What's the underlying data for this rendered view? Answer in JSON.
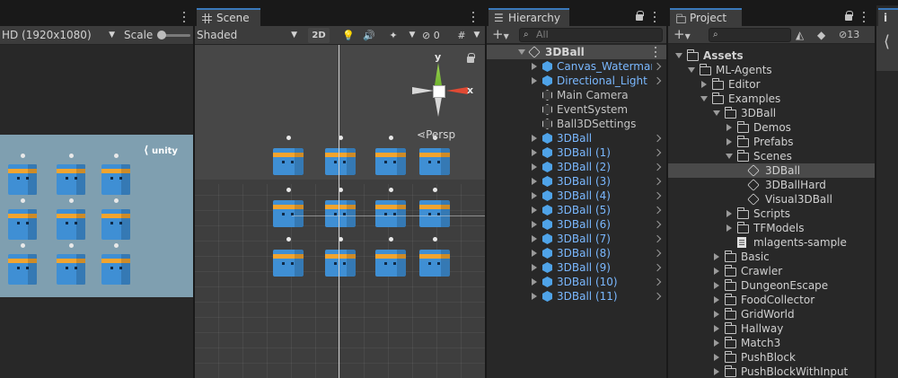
{
  "game": {
    "resolution": "HD (1920x1080)",
    "scale_label": "Scale",
    "logo_text": "unity"
  },
  "scene": {
    "tab_label": "Scene",
    "shading_mode": "Shaded",
    "btn_2d": "2D",
    "hidden_count": "0",
    "persp_label": "Persp",
    "axis_y": "y",
    "axis_x": "x"
  },
  "hierarchy": {
    "tab_label": "Hierarchy",
    "search_placeholder": "All",
    "root": "3DBall",
    "items": [
      {
        "label": "Canvas_Watermark",
        "type": "prefab",
        "expandable": true
      },
      {
        "label": "Directional_Light",
        "type": "prefab",
        "expandable": true
      },
      {
        "label": "Main Camera",
        "type": "object",
        "expandable": false
      },
      {
        "label": "EventSystem",
        "type": "object",
        "expandable": false
      },
      {
        "label": "Ball3DSettings",
        "type": "object",
        "expandable": false
      },
      {
        "label": "3DBall",
        "type": "prefab",
        "expandable": true
      },
      {
        "label": "3DBall (1)",
        "type": "prefab",
        "expandable": true
      },
      {
        "label": "3DBall (2)",
        "type": "prefab",
        "expandable": true
      },
      {
        "label": "3DBall (3)",
        "type": "prefab",
        "expandable": true
      },
      {
        "label": "3DBall (4)",
        "type": "prefab",
        "expandable": true
      },
      {
        "label": "3DBall (5)",
        "type": "prefab",
        "expandable": true
      },
      {
        "label": "3DBall (6)",
        "type": "prefab",
        "expandable": true
      },
      {
        "label": "3DBall (7)",
        "type": "prefab",
        "expandable": true
      },
      {
        "label": "3DBall (8)",
        "type": "prefab",
        "expandable": true
      },
      {
        "label": "3DBall (9)",
        "type": "prefab",
        "expandable": true
      },
      {
        "label": "3DBall (10)",
        "type": "prefab",
        "expandable": true
      },
      {
        "label": "3DBall (11)",
        "type": "prefab",
        "expandable": true
      }
    ]
  },
  "project": {
    "tab_label": "Project",
    "hidden_count": "13",
    "items": [
      {
        "label": "Assets",
        "depth": 0,
        "kind": "folder",
        "state": "open",
        "bold": true
      },
      {
        "label": "ML-Agents",
        "depth": 1,
        "kind": "folder",
        "state": "open"
      },
      {
        "label": "Editor",
        "depth": 2,
        "kind": "folder",
        "state": "closed"
      },
      {
        "label": "Examples",
        "depth": 2,
        "kind": "folder",
        "state": "open"
      },
      {
        "label": "3DBall",
        "depth": 3,
        "kind": "folder",
        "state": "open"
      },
      {
        "label": "Demos",
        "depth": 4,
        "kind": "folder",
        "state": "closed"
      },
      {
        "label": "Prefabs",
        "depth": 4,
        "kind": "folder",
        "state": "closed"
      },
      {
        "label": "Scenes",
        "depth": 4,
        "kind": "folder",
        "state": "open"
      },
      {
        "label": "3DBall",
        "depth": 5,
        "kind": "scene",
        "state": "none",
        "selected": true
      },
      {
        "label": "3DBallHard",
        "depth": 5,
        "kind": "scene",
        "state": "none"
      },
      {
        "label": "Visual3DBall",
        "depth": 5,
        "kind": "scene",
        "state": "none"
      },
      {
        "label": "Scripts",
        "depth": 4,
        "kind": "folder",
        "state": "closed"
      },
      {
        "label": "TFModels",
        "depth": 4,
        "kind": "folder",
        "state": "closed"
      },
      {
        "label": "mlagents-sample",
        "depth": 4,
        "kind": "file",
        "state": "none"
      },
      {
        "label": "Basic",
        "depth": 3,
        "kind": "folder",
        "state": "closed"
      },
      {
        "label": "Crawler",
        "depth": 3,
        "kind": "folder",
        "state": "closed"
      },
      {
        "label": "DungeonEscape",
        "depth": 3,
        "kind": "folder",
        "state": "closed"
      },
      {
        "label": "FoodCollector",
        "depth": 3,
        "kind": "folder",
        "state": "closed"
      },
      {
        "label": "GridWorld",
        "depth": 3,
        "kind": "folder",
        "state": "closed"
      },
      {
        "label": "Hallway",
        "depth": 3,
        "kind": "folder",
        "state": "closed"
      },
      {
        "label": "Match3",
        "depth": 3,
        "kind": "folder",
        "state": "closed"
      },
      {
        "label": "PushBlock",
        "depth": 3,
        "kind": "folder",
        "state": "closed"
      },
      {
        "label": "PushBlockWithInput",
        "depth": 3,
        "kind": "folder",
        "state": "closed"
      }
    ]
  },
  "colors": {
    "accent": "#3a79bb",
    "prefab_text": "#7ab8ff",
    "cube_blue": "#3f8fd4",
    "cube_band": "#f2a42e",
    "game_bg": "#7f9fb0"
  }
}
